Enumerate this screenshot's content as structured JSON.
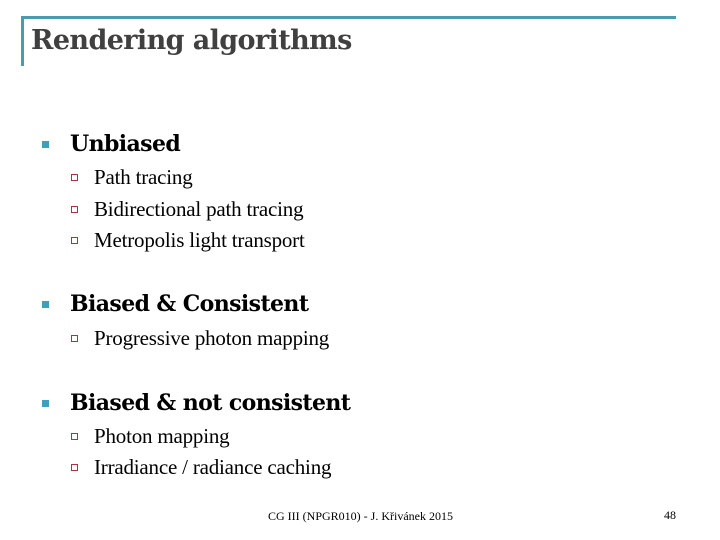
{
  "slide": {
    "title": "Rendering algorithms",
    "accent_color": "#4a9bae",
    "bullets": [
      {
        "label": "Unbiased",
        "items": [
          "Path tracing",
          "Bidirectional path tracing",
          "Metropolis light transport"
        ]
      },
      {
        "label": "Biased & Consistent",
        "items": [
          "Progressive photon mapping"
        ]
      },
      {
        "label": "Biased & not consistent",
        "items": [
          "Photon mapping",
          "Irradiance / radiance caching"
        ]
      }
    ],
    "footer": "CG III (NPGR010) - J. Křivánek 2015",
    "page_number": "48"
  },
  "icons": {
    "level1_bullet": "filled-square-bullet-icon",
    "level2_bullet": "hollow-square-bullet-icon"
  }
}
